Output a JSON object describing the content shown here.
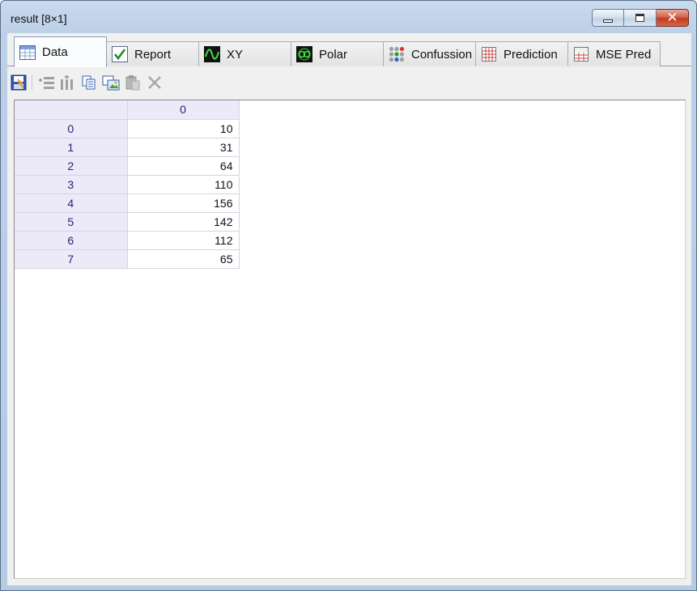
{
  "window": {
    "title": "result [8×1]"
  },
  "title_buttons": {
    "minimize": "minimize",
    "maximize": "restore",
    "close": "close"
  },
  "tabs": [
    {
      "label": "Data",
      "icon": "data-grid-icon",
      "active": true
    },
    {
      "label": "Report",
      "icon": "report-check-icon",
      "active": false
    },
    {
      "label": "XY",
      "icon": "xy-wave-icon",
      "active": false
    },
    {
      "label": "Polar",
      "icon": "polar-plot-icon",
      "active": false
    },
    {
      "label": "Confussion",
      "icon": "confusion-dots-icon",
      "active": false
    },
    {
      "label": "Prediction",
      "icon": "prediction-grid-icon",
      "active": false
    },
    {
      "label": "MSE Pred",
      "icon": "mse-pred-icon",
      "active": false
    }
  ],
  "toolbar": [
    {
      "icon": "save-icon",
      "enabled": true
    },
    {
      "icon": "insert-row-icon",
      "enabled": false
    },
    {
      "icon": "insert-column-icon",
      "enabled": false
    },
    {
      "icon": "copy-icon",
      "enabled": true
    },
    {
      "icon": "copy-image-icon",
      "enabled": true
    },
    {
      "icon": "paste-icon",
      "enabled": false
    },
    {
      "icon": "delete-icon",
      "enabled": false
    }
  ],
  "grid": {
    "column_headers": [
      "0"
    ],
    "rows": [
      {
        "header": "0",
        "values": [
          "10"
        ]
      },
      {
        "header": "1",
        "values": [
          "31"
        ]
      },
      {
        "header": "2",
        "values": [
          "64"
        ]
      },
      {
        "header": "3",
        "values": [
          "110"
        ]
      },
      {
        "header": "4",
        "values": [
          "156"
        ]
      },
      {
        "header": "5",
        "values": [
          "142"
        ]
      },
      {
        "header": "6",
        "values": [
          "112"
        ]
      },
      {
        "header": "7",
        "values": [
          "65"
        ]
      }
    ]
  },
  "colors": {
    "header_bg": "#eceaf8",
    "header_text": "#1c2a6a",
    "close_button": "#c03a20",
    "title_bar": "#bcd0e8"
  }
}
